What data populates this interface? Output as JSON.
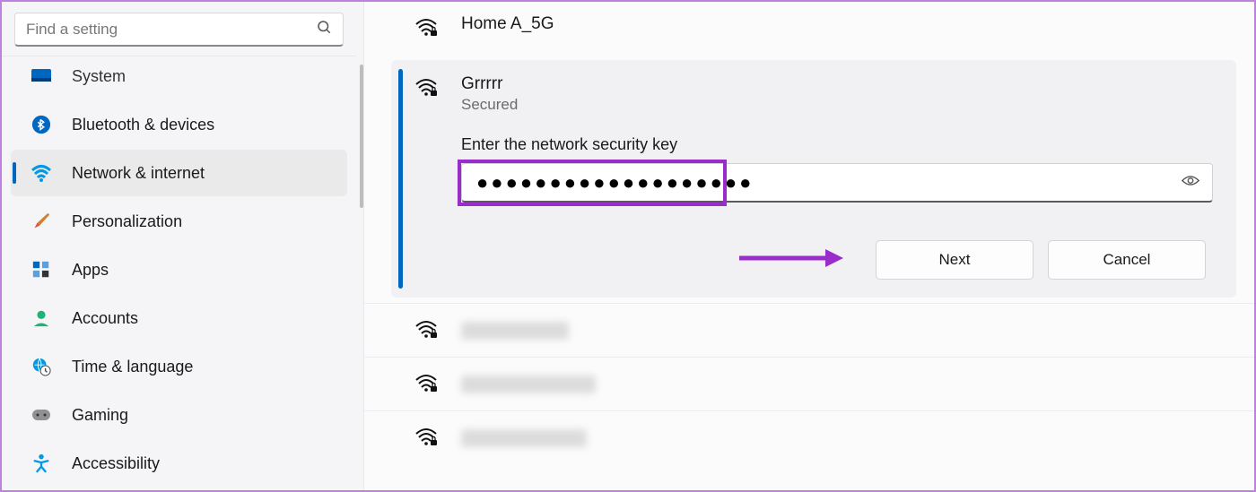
{
  "search": {
    "placeholder": "Find a setting"
  },
  "sidebar": {
    "items": [
      {
        "id": "system",
        "label": "System"
      },
      {
        "id": "bluetooth",
        "label": "Bluetooth & devices"
      },
      {
        "id": "network",
        "label": "Network & internet"
      },
      {
        "id": "personalization",
        "label": "Personalization"
      },
      {
        "id": "apps",
        "label": "Apps"
      },
      {
        "id": "accounts",
        "label": "Accounts"
      },
      {
        "id": "time",
        "label": "Time & language"
      },
      {
        "id": "gaming",
        "label": "Gaming"
      },
      {
        "id": "accessibility",
        "label": "Accessibility"
      }
    ]
  },
  "networks": {
    "above": {
      "name": "Home A_5G"
    },
    "selected": {
      "name": "Grrrrr",
      "status": "Secured",
      "prompt": "Enter the network security key",
      "password_masked": "●●●●●●●●●●●●●●●●●●●",
      "buttons": {
        "next": "Next",
        "cancel": "Cancel"
      }
    }
  }
}
